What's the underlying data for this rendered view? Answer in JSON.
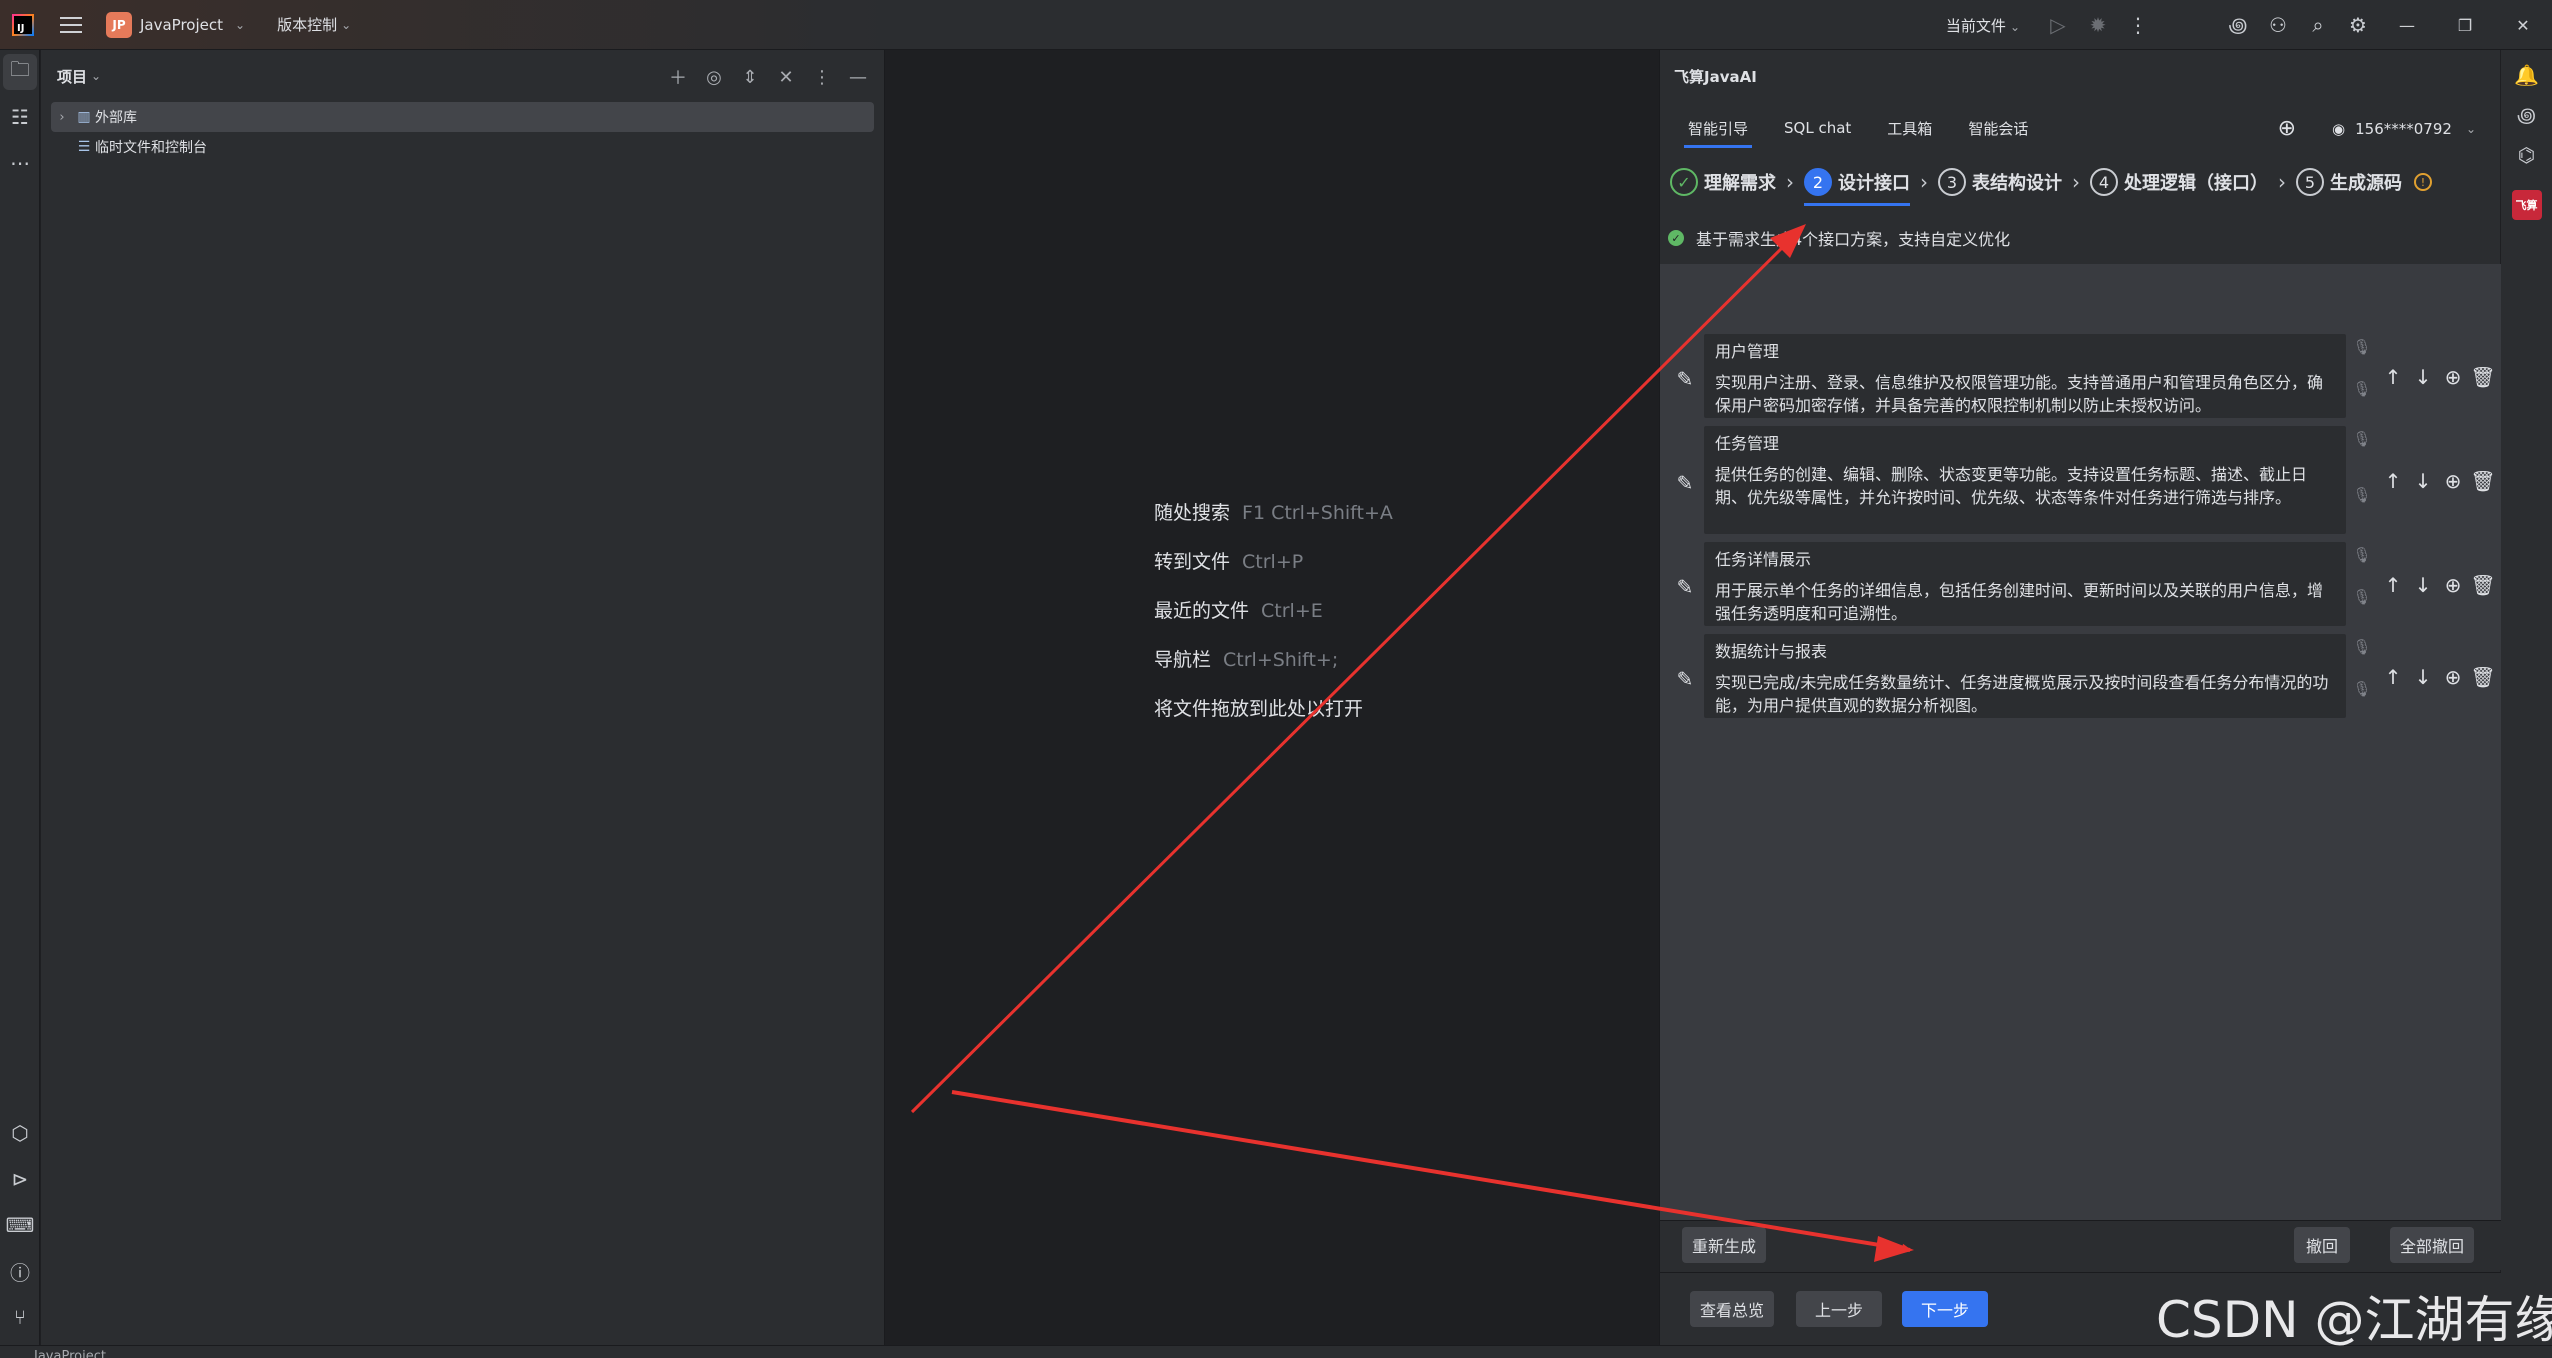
{
  "titlebar": {
    "logo_text": "IJ",
    "project_badge": "JP",
    "project_name": "JavaProject",
    "vcs_label": "版本控制",
    "current_file_label": "当前文件"
  },
  "project_panel": {
    "title": "项目",
    "tree": [
      {
        "label": "外部库"
      },
      {
        "label": "临时文件和控制台"
      }
    ]
  },
  "editor": {
    "hints": [
      {
        "label": "随处搜索",
        "keys": "F1 Ctrl+Shift+A"
      },
      {
        "label": "转到文件",
        "keys": "Ctrl+P"
      },
      {
        "label": "最近的文件",
        "keys": "Ctrl+E"
      },
      {
        "label": "导航栏",
        "keys": "Ctrl+Shift+;"
      },
      {
        "label": "将文件拖放到此处以打开",
        "keys": ""
      }
    ]
  },
  "ai_panel": {
    "title": "飞算JavaAI",
    "tabs": [
      {
        "label": "智能引导"
      },
      {
        "label": "SQL chat"
      },
      {
        "label": "工具箱"
      },
      {
        "label": "智能会话"
      }
    ],
    "user": "156****0792",
    "steps": [
      {
        "num": "✓",
        "label": "理解需求"
      },
      {
        "num": "2",
        "label": "设计接口"
      },
      {
        "num": "3",
        "label": "表结构设计"
      },
      {
        "num": "4",
        "label": "处理逻辑（接口）"
      },
      {
        "num": "5",
        "label": "生成源码"
      }
    ],
    "status_text": "基于需求生成4个接口方案，支持自定义优化",
    "interfaces": [
      {
        "title": "用户管理",
        "desc": "实现用户注册、登录、信息维护及权限管理功能。支持普通用户和管理员角色区分，确保用户密码加密存储，并具备完善的权限控制机制以防止未授权访问。"
      },
      {
        "title": "任务管理",
        "desc": "提供任务的创建、编辑、删除、状态变更等功能。支持设置任务标题、描述、截止日期、优先级等属性，并允许按时间、优先级、状态等条件对任务进行筛选与排序。"
      },
      {
        "title": "任务详情展示",
        "desc": "用于展示单个任务的详细信息，包括任务创建时间、更新时间以及关联的用户信息，增强任务透明度和可追溯性。"
      },
      {
        "title": "数据统计与报表",
        "desc": "实现已完成/未完成任务数量统计、任务进度概览展示及按时间段查看任务分布情况的功能，为用户提供直观的数据分析视图。"
      }
    ],
    "buttons": {
      "regenerate": "重新生成",
      "undo": "撤回",
      "undo_all": "全部撤回",
      "overview": "查看总览",
      "prev": "上一步",
      "next": "下一步"
    }
  },
  "right_strip": {
    "plugin_badge": "飞算"
  },
  "statusbar": {
    "project": "JavaProject"
  },
  "watermark": "CSDN @江湖有缘",
  "colors": {
    "accent": "#3574f0",
    "success": "#5fb865",
    "annotation_arrow": "#e8322e"
  }
}
